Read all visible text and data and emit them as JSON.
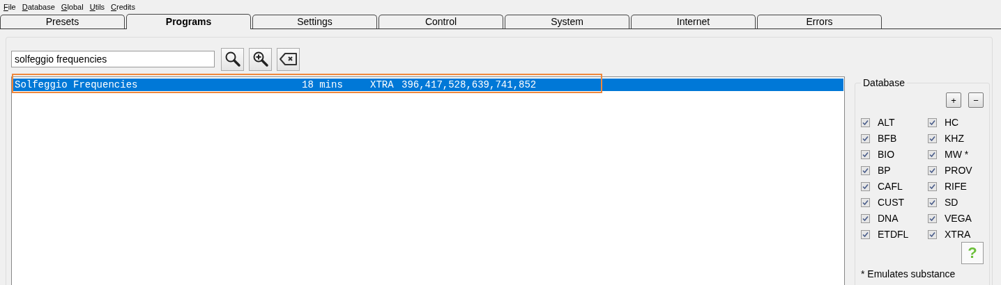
{
  "menu": [
    "File",
    "Database",
    "Global",
    "Utils",
    "Credits"
  ],
  "tabs": [
    {
      "label": "Presets",
      "selected": false
    },
    {
      "label": "Programs",
      "selected": true
    },
    {
      "label": "Settings",
      "selected": false
    },
    {
      "label": "Control",
      "selected": false
    },
    {
      "label": "System",
      "selected": false
    },
    {
      "label": "Internet",
      "selected": false
    },
    {
      "label": "Errors",
      "selected": false
    }
  ],
  "search": {
    "value": "solfeggio frequencies"
  },
  "results": [
    {
      "name": "Solfeggio Frequencies",
      "duration": "18 mins",
      "database": "XTRA",
      "frequencies": "396,417,528,639,741,852",
      "selected": true,
      "highlighted": true
    }
  ],
  "database": {
    "title": "Database",
    "add": "+",
    "remove": "−",
    "help": "?",
    "items": [
      {
        "label": "ALT",
        "checked": true
      },
      {
        "label": "HC",
        "checked": true
      },
      {
        "label": "BFB",
        "checked": true
      },
      {
        "label": "KHZ",
        "checked": true
      },
      {
        "label": "BIO",
        "checked": true
      },
      {
        "label": "MW *",
        "checked": true
      },
      {
        "label": "BP",
        "checked": true
      },
      {
        "label": "PROV",
        "checked": true
      },
      {
        "label": "CAFL",
        "checked": true
      },
      {
        "label": "RIFE",
        "checked": true
      },
      {
        "label": "CUST",
        "checked": true
      },
      {
        "label": "SD",
        "checked": true
      },
      {
        "label": "DNA",
        "checked": true
      },
      {
        "label": "VEGA",
        "checked": true
      },
      {
        "label": "ETDFL",
        "checked": true
      },
      {
        "label": "XTRA",
        "checked": true
      }
    ],
    "note": "* Emulates substance"
  }
}
